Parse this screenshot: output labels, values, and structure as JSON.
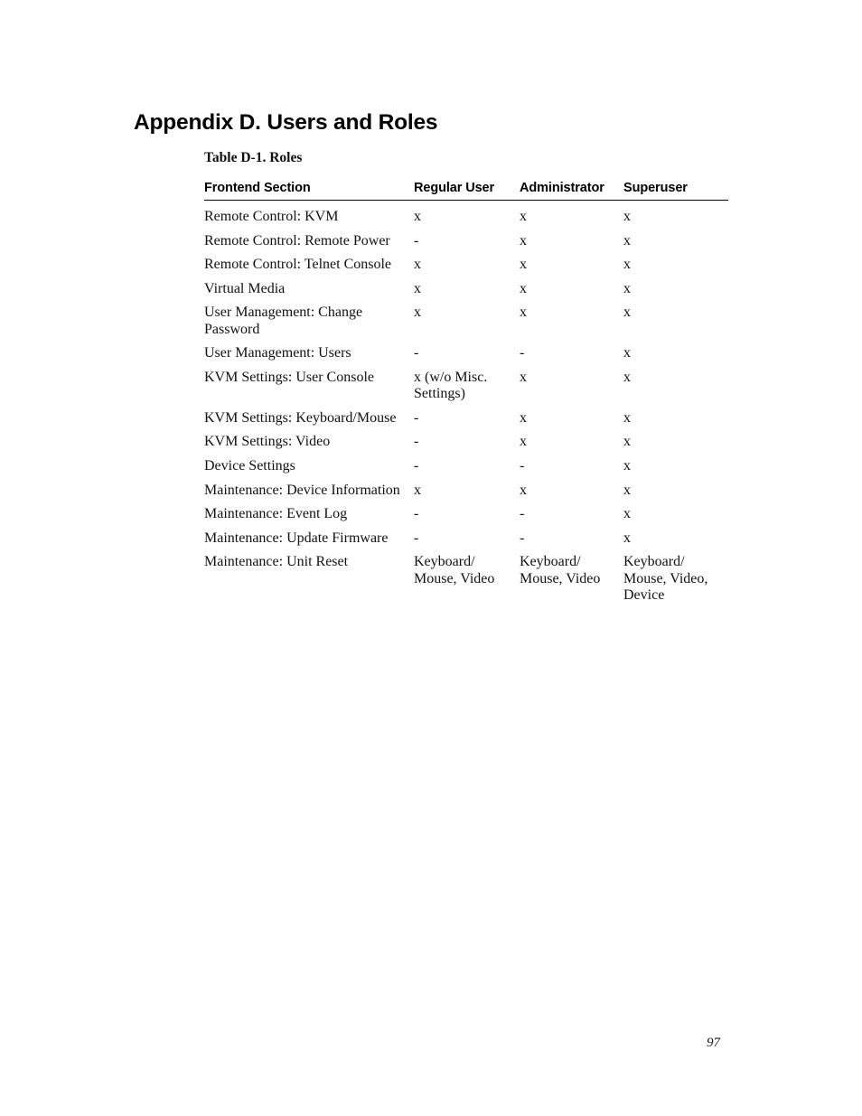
{
  "page": {
    "title": "Appendix D. Users and Roles",
    "page_number": "97",
    "background_color": "#ffffff",
    "text_color": "#000000"
  },
  "table": {
    "caption": "Table D-1. Roles",
    "columns": [
      {
        "key": "section",
        "label": "Frontend Section"
      },
      {
        "key": "regular",
        "label": "Regular User"
      },
      {
        "key": "admin",
        "label": "Administrator"
      },
      {
        "key": "super",
        "label": "Superuser"
      }
    ],
    "rows": [
      {
        "section": "Remote Control: KVM",
        "regular": "x",
        "admin": "x",
        "super": "x"
      },
      {
        "section": "Remote Control: Remote Power",
        "regular": "-",
        "admin": "x",
        "super": "x"
      },
      {
        "section": "Remote Control: Telnet Console",
        "regular": "x",
        "admin": "x",
        "super": "x"
      },
      {
        "section": "Virtual Media",
        "regular": "x",
        "admin": "x",
        "super": "x"
      },
      {
        "section": "User Management: Change Password",
        "regular": "x",
        "admin": "x",
        "super": "x"
      },
      {
        "section": "User Management: Users",
        "regular": "-",
        "admin": "-",
        "super": "x"
      },
      {
        "section": "KVM Settings: User Console",
        "regular": "x (w/o Misc. Settings)",
        "admin": "x",
        "super": "x"
      },
      {
        "section": "KVM Settings: Keyboard/Mouse",
        "regular": "-",
        "admin": "x",
        "super": "x"
      },
      {
        "section": "KVM Settings: Video",
        "regular": "-",
        "admin": "x",
        "super": "x"
      },
      {
        "section": "Device Settings",
        "regular": "-",
        "admin": "-",
        "super": "x"
      },
      {
        "section": "Maintenance: Device Information",
        "regular": "x",
        "admin": "x",
        "super": "x"
      },
      {
        "section": "Maintenance: Event Log",
        "regular": "-",
        "admin": "-",
        "super": "x"
      },
      {
        "section": "Maintenance: Update Firmware",
        "regular": "-",
        "admin": "-",
        "super": "x"
      },
      {
        "section": "Maintenance: Unit Reset",
        "regular": "Keyboard/ Mouse, Video",
        "admin": "Keyboard/ Mouse, Video",
        "super": "Keyboard/ Mouse, Video, Device"
      }
    ]
  }
}
